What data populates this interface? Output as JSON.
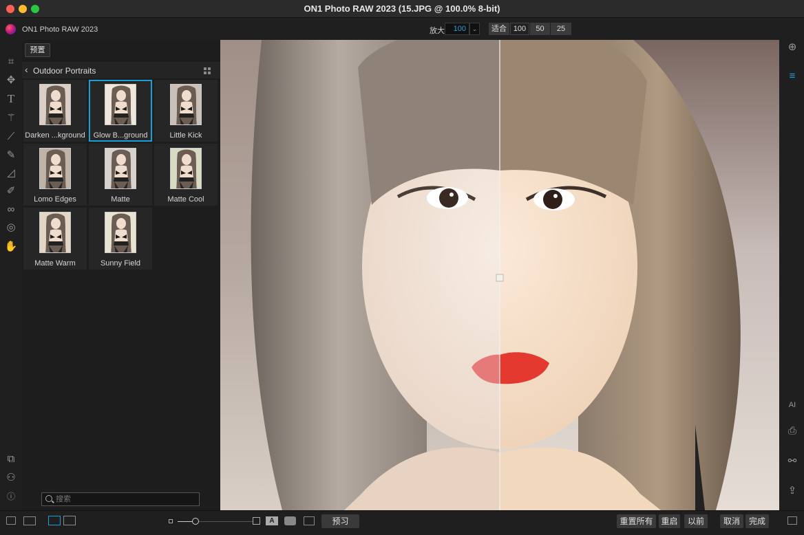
{
  "window": {
    "title": "ON1 Photo RAW 2023 (15.JPG @ 100.0% 8-bit)"
  },
  "toolbar": {
    "app_name": "ON1 Photo RAW 2023",
    "zoom_label": "放大",
    "zoom_value": "100",
    "fit_label": "适合",
    "zoom_presets": [
      "100",
      "50",
      "25"
    ]
  },
  "panel": {
    "tab_label": "预置",
    "category_title": "Outdoor Portraits",
    "presets": [
      {
        "label": "Darken ...kground",
        "selected": false,
        "tint": "#d8d0c6"
      },
      {
        "label": "Glow B...ground",
        "selected": true,
        "tint": "#efe6dc"
      },
      {
        "label": "Little Kick",
        "selected": false,
        "tint": "#c9c0b8"
      },
      {
        "label": "Lomo Edges",
        "selected": false,
        "tint": "#bdb3a7"
      },
      {
        "label": "Matte",
        "selected": false,
        "tint": "#d7d2cb"
      },
      {
        "label": "Matte Cool",
        "selected": false,
        "tint": "#d8dac4"
      },
      {
        "label": "Matte Warm",
        "selected": false,
        "tint": "#e2d6c4"
      },
      {
        "label": "Sunny Field",
        "selected": false,
        "tint": "#e9e3d2"
      }
    ],
    "search_placeholder": "搜索"
  },
  "bottom": {
    "preview_label": "预习",
    "reset_all_label": "重置所有",
    "reset_label": "重启",
    "before_label": "以前",
    "cancel_label": "取消",
    "done_label": "完成"
  },
  "colors": {
    "accent": "#1a9fd6",
    "traffic_close": "#fe5f57",
    "traffic_min": "#febc2e",
    "traffic_max": "#28c840"
  }
}
